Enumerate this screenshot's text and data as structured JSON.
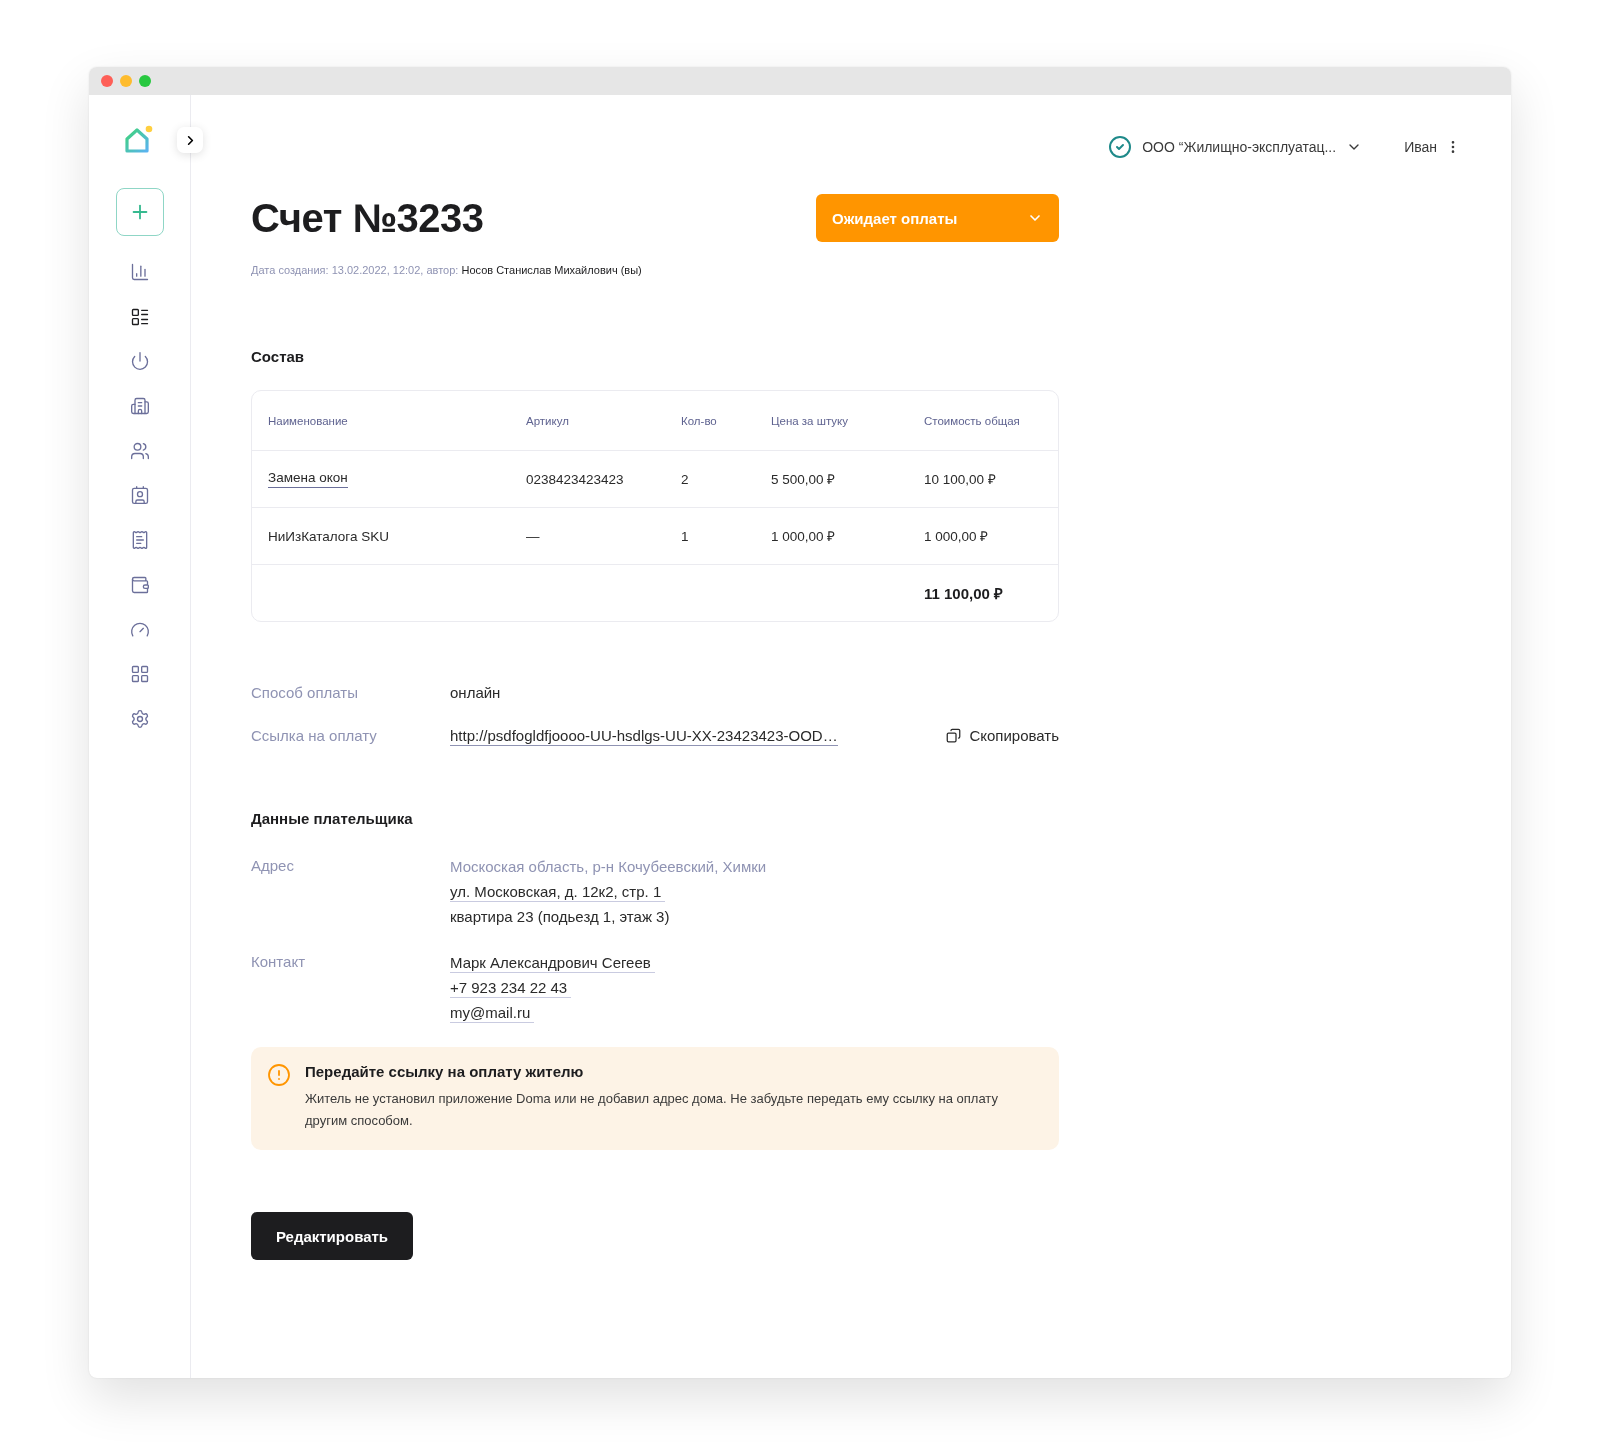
{
  "window": {
    "controls": [
      {
        "color": "#fe5f57"
      },
      {
        "color": "#febc2e"
      },
      {
        "color": "#28c840"
      }
    ]
  },
  "sidebar": {
    "items": [
      {
        "selected": false
      },
      {
        "selected": true
      },
      {
        "selected": false
      },
      {
        "selected": false
      },
      {
        "selected": false
      },
      {
        "selected": false
      },
      {
        "selected": false
      },
      {
        "selected": false
      },
      {
        "selected": false
      },
      {
        "selected": false
      },
      {
        "selected": false
      }
    ]
  },
  "header": {
    "organization": "ООО “Жилищно-эксплуатац...",
    "user": "Иван"
  },
  "invoice": {
    "title": "Счет №3233",
    "status": "Ожидает оплаты",
    "meta_label": "Дата создания: 13.02.2022, 12:02, автор:",
    "author": "Носов Станислав Михайлович (вы)"
  },
  "composition": {
    "title": "Состав",
    "table": {
      "columns": [
        "Наименование",
        "Артикул",
        "Кол-во",
        "Цена за штуку",
        "Стоимость общая"
      ],
      "rows": [
        {
          "cells": [
            "Замена окон",
            "0238423423423",
            "2",
            "5 500,00 ₽",
            "10 100,00 ₽"
          ],
          "link": true
        },
        {
          "cells": [
            "НиИзКаталога SKU",
            "—",
            "1",
            "1 000,00 ₽",
            "1 000,00 ₽"
          ],
          "link": false
        }
      ],
      "total": "11 100,00 ₽"
    }
  },
  "payment": {
    "method_label": "Способ оплаты",
    "method": "онлайн",
    "link_label": "Ссылка на оплату",
    "link": "http://psdfogldfjoooo-UU-hsdlgs-UU-XX-23423423-OOD…",
    "copy": "Скопировать"
  },
  "payer": {
    "title": "Данные плательщика",
    "fields": [
      {
        "label": "Адрес",
        "lines": [
          {
            "text": "Москоская область, р-н Кочубеевский, Химки",
            "kind": "muted"
          },
          {
            "text": "ул. Московская, д. 12к2, стр. 1",
            "kind": "link"
          },
          {
            "text": "квартира 23 (подьезд 1, этаж 3)",
            "kind": "plain"
          }
        ]
      },
      {
        "label": "Контакт",
        "lines": [
          {
            "text": "Марк Александрович Сегеев",
            "kind": "link"
          },
          {
            "text": "+7 923 234 22 43",
            "kind": "link"
          },
          {
            "text": "my@mail.ru",
            "kind": "link"
          }
        ]
      }
    ]
  },
  "notice": {
    "title": "Передайте ссылку на оплату жителю",
    "text": "Житель не установил приложение Doma или не добавил адрес дома. Не забудьте передать ему ссылку на оплату другим способом."
  },
  "edit_button": "Редактировать"
}
